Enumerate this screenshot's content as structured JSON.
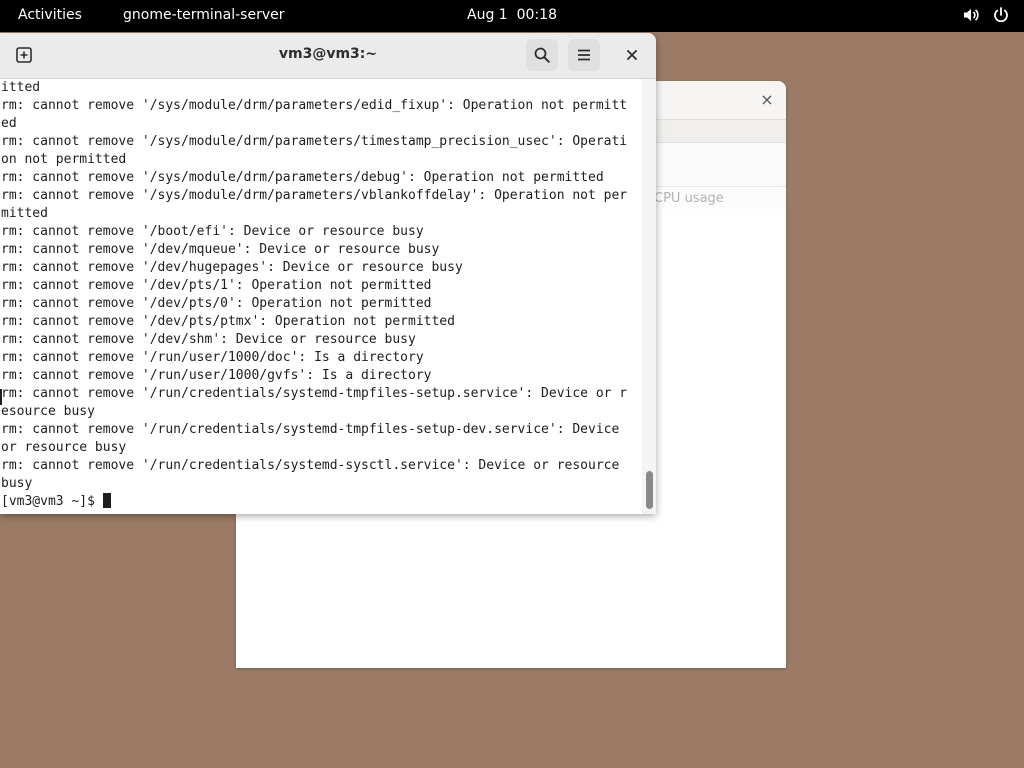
{
  "topbar": {
    "activities": "Activities",
    "app_name": "gnome-terminal-server",
    "date": "Aug 1",
    "time": "00:18",
    "volume_icon": "volume-icon",
    "power_icon": "power-icon"
  },
  "background_window": {
    "close_glyph": "×",
    "column_label": "CPU usage"
  },
  "terminal": {
    "title": "vm3@vm3:~",
    "close_glyph": "×",
    "lines": [
      "itted",
      "rm: cannot remove '/sys/module/drm/parameters/edid_fixup': Operation not permitt",
      "ed",
      "rm: cannot remove '/sys/module/drm/parameters/timestamp_precision_usec': Operati",
      "on not permitted",
      "rm: cannot remove '/sys/module/drm/parameters/debug': Operation not permitted",
      "rm: cannot remove '/sys/module/drm/parameters/vblankoffdelay': Operation not per",
      "mitted",
      "rm: cannot remove '/boot/efi': Device or resource busy",
      "rm: cannot remove '/dev/mqueue': Device or resource busy",
      "rm: cannot remove '/dev/hugepages': Device or resource busy",
      "rm: cannot remove '/dev/pts/1': Operation not permitted",
      "rm: cannot remove '/dev/pts/0': Operation not permitted",
      "rm: cannot remove '/dev/pts/ptmx': Operation not permitted",
      "rm: cannot remove '/dev/shm': Device or resource busy",
      "rm: cannot remove '/run/user/1000/doc': Is a directory",
      "rm: cannot remove '/run/user/1000/gvfs': Is a directory",
      "rm: cannot remove '/run/credentials/systemd-tmpfiles-setup.service': Device or r",
      "esource busy",
      "rm: cannot remove '/run/credentials/systemd-tmpfiles-setup-dev.service': Device",
      "or resource busy",
      "rm: cannot remove '/run/credentials/systemd-sysctl.service': Device or resource",
      "busy"
    ],
    "prompt": "[vm3@vm3 ~]$ "
  },
  "colors": {
    "desktop": "#9b7b65",
    "topbar": "#000000",
    "terminal_text": "#1e1e1e"
  }
}
